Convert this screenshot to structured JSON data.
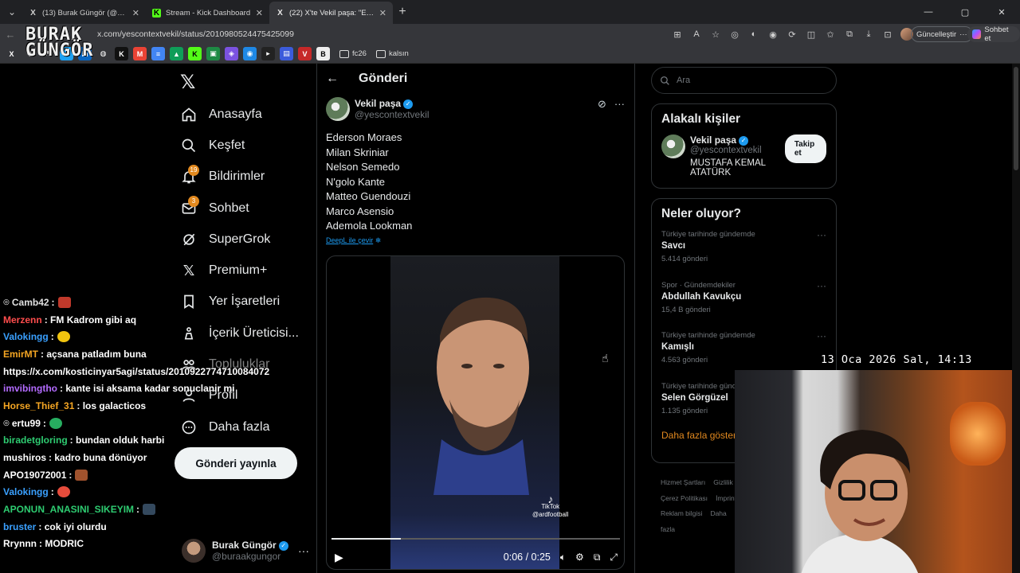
{
  "browser": {
    "tabs": [
      {
        "icon": "X",
        "title": "(13) Burak Güngör (@buraakgungor",
        "active": false
      },
      {
        "icon": "K",
        "title": "Stream - Kick Dashboard",
        "active": false
      },
      {
        "icon": "X",
        "title": "(22) X'te Vekil paşa: \"Ederson Mora",
        "active": true
      }
    ],
    "url": "x.com/yescontextvekil/status/2010980524475425099",
    "update_label": "Güncelleştir",
    "chat_label": "Sohbet et",
    "bookmark_folders": [
      "fc26",
      "kalsın"
    ]
  },
  "stream_logo": {
    "line1": "BURAK",
    "line2": "GÜNGÖR"
  },
  "nav": {
    "items": [
      {
        "icon": "home-icon",
        "label": "Anasayfa"
      },
      {
        "icon": "search-icon",
        "label": "Keşfet"
      },
      {
        "icon": "bell-icon",
        "label": "Bildirimler",
        "badge": "19"
      },
      {
        "icon": "mail-icon",
        "label": "Sohbet",
        "badge": "3"
      },
      {
        "icon": "grok-icon",
        "label": "SuperGrok"
      },
      {
        "icon": "x-premium-icon",
        "label": "Premium+"
      },
      {
        "icon": "bookmark-icon",
        "label": "Yer İşaretleri"
      },
      {
        "icon": "creator-icon",
        "label": "İçerik Üreticisi..."
      },
      {
        "icon": "community-icon",
        "label": "Topluluklar"
      },
      {
        "icon": "profile-icon",
        "label": "Profil"
      },
      {
        "icon": "more-circle-icon",
        "label": "Daha fazla"
      }
    ],
    "post_button": "Gönderi yayınla",
    "account": {
      "name": "Burak Güngör",
      "handle": "@buraakgungor"
    }
  },
  "chat": [
    {
      "user": "Camb42",
      "color": "#e0e0e0",
      "message": ""
    },
    {
      "user": "Merzenn",
      "color": "#ff4d4d",
      "message": "FM Kadrom gibi aq"
    },
    {
      "user": "Valokingg",
      "color": "#3aa0ff",
      "message": ""
    },
    {
      "user": "EmirMT",
      "color": "#f5a623",
      "message": "açsana patladım buna"
    },
    {
      "user": "",
      "color": "#ffffff",
      "message": "https://x.com/kosticinyar5agi/status/2010922774710084072"
    },
    {
      "user": "imvibingtho",
      "color": "#b36bff",
      "message": "kante isi aksama kadar sonuclanir mi"
    },
    {
      "user": "Horse_Thief_31",
      "color": "#f5a623",
      "message": "los galacticos"
    },
    {
      "user": "ertu99",
      "color": "#ffffff",
      "message": ""
    },
    {
      "user": "biradetgloring",
      "color": "#2ecc71",
      "message": "bundan olduk harbi"
    },
    {
      "user": "mushiros",
      "color": "#ffffff",
      "message": "kadro buna dönüyor"
    },
    {
      "user": "APO19072001",
      "color": "#ffffff",
      "message": ""
    },
    {
      "user": "Valokingg",
      "color": "#3aa0ff",
      "message": ""
    },
    {
      "user": "APONUN_ANASINI_SIKEYIM",
      "color": "#2ecc71",
      "message": ""
    },
    {
      "user": "bruster",
      "color": "#3aa0ff",
      "message": "cok iyi olurdu"
    },
    {
      "user": "Rrynnn",
      "color": "#ffffff",
      "message": "MODRIC"
    }
  ],
  "post": {
    "page_title": "Gönderi",
    "author_name": "Vekil paşa",
    "author_handle": "@yescontextvekil",
    "lines": [
      "Ederson Moraes",
      "Milan Skriniar",
      "Nelson Semedo",
      "N'golo Kante",
      "Matteo Guendouzi",
      "Marco Asensio",
      "Ademola Lookman"
    ],
    "translate_label": "DeepL ile çevir",
    "video": {
      "time": "0:06 / 0:25",
      "progress": 0.24,
      "watermark": "TikTok",
      "watermark_handle": "@ardfootball"
    }
  },
  "sidebar": {
    "search_placeholder": "Ara",
    "related_title": "Alakalı kişiler",
    "related": {
      "name": "Vekil paşa",
      "handle": "@yescontextvekil",
      "bio": "MUSTAFA KEMAL ATATÜRK",
      "follow": "Takip et"
    },
    "trends_title": "Neler oluyor?",
    "trends": [
      {
        "context": "Türkiye tarihinde gündemde",
        "name": "Savcı",
        "count": "5.414 gönderi"
      },
      {
        "context": "Spor · Gündemdekiler",
        "name": "Abdullah Kavukçu",
        "count": "15,4 B gönderi"
      },
      {
        "context": "Türkiye tarihinde gündemde",
        "name": "Kamışlı",
        "count": "4.563 gönderi"
      },
      {
        "context": "Türkiye tarihinde gündemde",
        "name": "Selen Görgüzel",
        "count": "1.135 gönderi"
      }
    ],
    "show_more": "Daha fazla göster",
    "footer": [
      "Hizmet Şartları",
      "Gizlilik",
      "Çerez Politikası",
      "İmprint",
      "Reklam bilgisi",
      "Daha fazla"
    ]
  },
  "overlay": {
    "clock": "13 Oca 2026 Sal, 14:13"
  }
}
